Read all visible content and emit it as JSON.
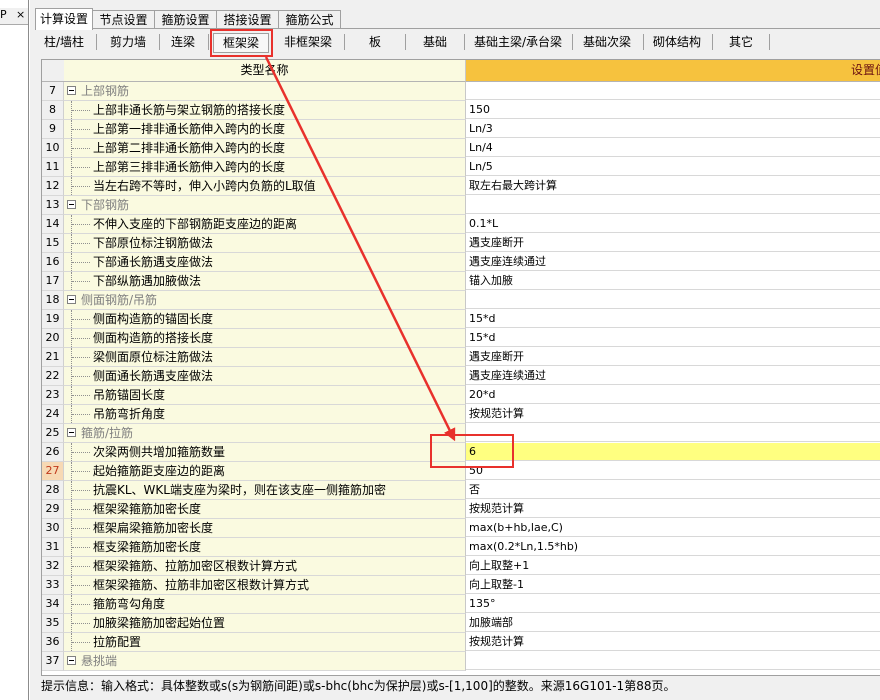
{
  "left_panel": {
    "glyph": "P",
    "close": "×"
  },
  "tabs": [
    {
      "label": "计算设置"
    },
    {
      "label": "节点设置"
    },
    {
      "label": "箍筋设置"
    },
    {
      "label": "搭接设置"
    },
    {
      "label": "箍筋公式"
    }
  ],
  "subtabs": [
    {
      "label": "柱/墙柱"
    },
    {
      "label": "剪力墙"
    },
    {
      "label": "连梁"
    },
    {
      "label": "框架梁"
    },
    {
      "label": "非框架梁"
    },
    {
      "label": "板"
    },
    {
      "label": "基础"
    },
    {
      "label": "基础主梁/承台梁"
    },
    {
      "label": "基础次梁"
    },
    {
      "label": "砌体结构"
    },
    {
      "label": "其它"
    }
  ],
  "grid": {
    "header_name": "类型名称",
    "header_value": "设置值",
    "rows": [
      {
        "no": "7",
        "name": "上部钢筋",
        "value": "",
        "group": true
      },
      {
        "no": "8",
        "name": "上部非通长筋与架立钢筋的搭接长度",
        "value": "150"
      },
      {
        "no": "9",
        "name": "上部第一排非通长筋伸入跨内的长度",
        "value": "Ln/3"
      },
      {
        "no": "10",
        "name": "上部第二排非通长筋伸入跨内的长度",
        "value": "Ln/4"
      },
      {
        "no": "11",
        "name": "上部第三排非通长筋伸入跨内的长度",
        "value": "Ln/5"
      },
      {
        "no": "12",
        "name": "当左右跨不等时，伸入小跨内负筋的L取值",
        "value": "取左右最大跨计算"
      },
      {
        "no": "13",
        "name": "下部钢筋",
        "value": "",
        "group": true
      },
      {
        "no": "14",
        "name": "不伸入支座的下部钢筋距支座边的距离",
        "value": "0.1*L"
      },
      {
        "no": "15",
        "name": "下部原位标注钢筋做法",
        "value": "遇支座断开"
      },
      {
        "no": "16",
        "name": "下部通长筋遇支座做法",
        "value": "遇支座连续通过"
      },
      {
        "no": "17",
        "name": "下部纵筋遇加腋做法",
        "value": "锚入加腋"
      },
      {
        "no": "18",
        "name": "侧面钢筋/吊筋",
        "value": "",
        "group": true
      },
      {
        "no": "19",
        "name": "侧面构造筋的锚固长度",
        "value": "15*d"
      },
      {
        "no": "20",
        "name": "侧面构造筋的搭接长度",
        "value": "15*d"
      },
      {
        "no": "21",
        "name": "梁侧面原位标注筋做法",
        "value": "遇支座断开"
      },
      {
        "no": "22",
        "name": "侧面通长筋遇支座做法",
        "value": "遇支座连续通过"
      },
      {
        "no": "23",
        "name": "吊筋锚固长度",
        "value": "20*d"
      },
      {
        "no": "24",
        "name": "吊筋弯折角度",
        "value": "按规范计算"
      },
      {
        "no": "25",
        "name": "箍筋/拉筋",
        "value": "",
        "group": true
      },
      {
        "no": "26",
        "name": "次梁两侧共增加箍筋数量",
        "value": "6",
        "highlight": true
      },
      {
        "no": "27",
        "name": "起始箍筋距支座边的距离",
        "value": "50",
        "current": true
      },
      {
        "no": "28",
        "name": "抗震KL、WKL端支座为梁时，则在该支座一侧箍筋加密",
        "value": "否"
      },
      {
        "no": "29",
        "name": "框架梁箍筋加密长度",
        "value": "按规范计算"
      },
      {
        "no": "30",
        "name": "框架扁梁箍筋加密长度",
        "value": "max(b+hb,lae,C)"
      },
      {
        "no": "31",
        "name": "框支梁箍筋加密长度",
        "value": "max(0.2*Ln,1.5*hb)"
      },
      {
        "no": "32",
        "name": "框架梁箍筋、拉筋加密区根数计算方式",
        "value": "向上取整+1"
      },
      {
        "no": "33",
        "name": "框架梁箍筋、拉筋非加密区根数计算方式",
        "value": "向上取整-1"
      },
      {
        "no": "34",
        "name": "箍筋弯勾角度",
        "value": "135°"
      },
      {
        "no": "35",
        "name": "加腋梁箍筋加密起始位置",
        "value": "加腋端部"
      },
      {
        "no": "36",
        "name": "拉筋配置",
        "value": "按规范计算"
      },
      {
        "no": "37",
        "name": "悬挑端",
        "value": "",
        "group": true
      }
    ]
  },
  "status": {
    "text": "提示信息：输入格式：具体整数或s(s为钢筋间距)或s-bhc(bhc为保护层)或s-[1,100]的整数。来源16G101-1第88页。"
  },
  "colors": {
    "annotation": "#e8312c",
    "header_value_bg": "#f6c23e",
    "name_bg": "#fafae0",
    "highlight": "#ffff80"
  }
}
